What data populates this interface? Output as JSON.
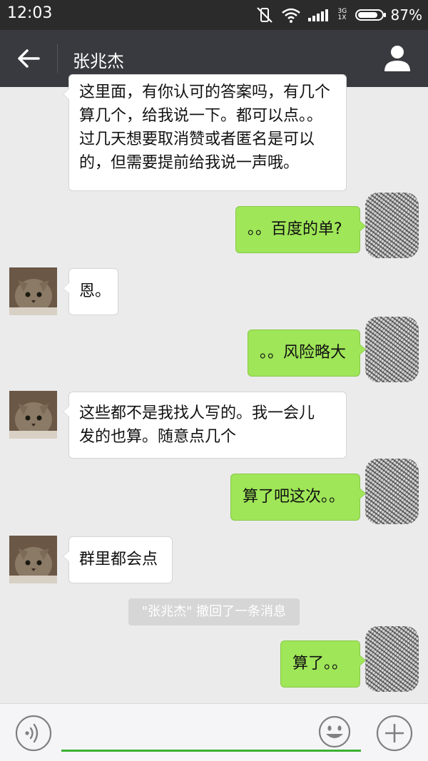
{
  "status_bar": {
    "time": "12:03",
    "network_top": "3G",
    "network_bottom": "1X",
    "battery_percent": "87%",
    "battery_level": 0.87
  },
  "header": {
    "title": "张兆杰"
  },
  "messages": [
    {
      "side": "in",
      "lines": [
        "这里面，有你认可的答案吗，有几个",
        "算几个，给我说一下。都可以点。。",
        "过几天想要取消赞或者匿名是可以",
        "的，但需要提前给我说一声哦。"
      ]
    },
    {
      "side": "out",
      "lines": [
        "。。百度的单?"
      ]
    },
    {
      "side": "in",
      "lines": [
        "恩。"
      ]
    },
    {
      "side": "out",
      "lines": [
        "。。风险略大"
      ]
    },
    {
      "side": "in",
      "lines": [
        "这些都不是我找人写的。我一会儿",
        "发的也算。随意点几个"
      ]
    },
    {
      "side": "out",
      "lines": [
        "算了吧这次。。"
      ]
    },
    {
      "side": "in",
      "lines": [
        "群里都会点"
      ]
    },
    {
      "side": "out",
      "lines": [
        "算了。。"
      ]
    }
  ],
  "system_notice": "\"张兆杰\" 撤回了一条消息",
  "input": {
    "value": "",
    "placeholder": ""
  },
  "colors": {
    "status_bar": "#2b2b2b",
    "title_bar": "#393a3f",
    "chat_background": "#ebebeb",
    "incoming_bubble": "#ffffff",
    "outgoing_bubble": "#9fe658",
    "input_underline": "#3cb034"
  }
}
